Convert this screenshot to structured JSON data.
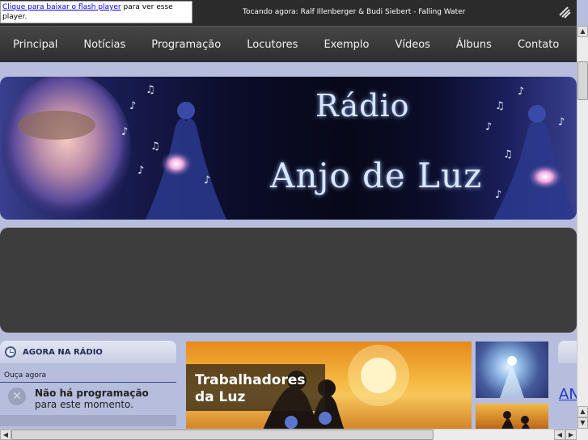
{
  "player": {
    "flash_link": "Clique para baixar o flash player",
    "flash_rest": " para ver esse player.",
    "now_playing": "Tocando agora: Ralf Illenberger & Budi Siebert - Falling Water"
  },
  "nav": {
    "items": [
      "Principal",
      "Notícias",
      "Programação",
      "Locutores",
      "Exemplo",
      "Vídeos",
      "Álbuns",
      "Contato"
    ]
  },
  "banner": {
    "title_line1": "Rádio",
    "title_line2": "Anjo de Luz"
  },
  "widget": {
    "title": "AGORA NA RÁDIO",
    "subtitle": "Ouça agora",
    "message_bold": "Não há programação",
    "message_rest": "para este momento."
  },
  "feature": {
    "caption_line1": "Trabalhadores",
    "caption_line2": "da Luz"
  },
  "right_panel": {
    "link_text": "AN"
  },
  "colors": {
    "page_bg": "#b6bddd",
    "nav_bg": "#3a3a3a",
    "dark_box": "#3d3d3d",
    "link": "#1a37c8"
  }
}
